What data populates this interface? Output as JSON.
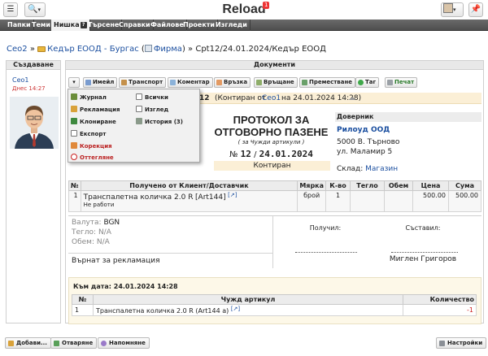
{
  "app": {
    "title": "Reload",
    "badge": "1"
  },
  "menu": [
    "Папки",
    "Теми",
    "Нишка",
    "Търсене",
    "Справки",
    "Файлове",
    "Проекти",
    "Изгледи"
  ],
  "breadcrumb": {
    "user": "Ceo2",
    "folder": "Кедър ЕООД - Бургас",
    "firm": "Фирма",
    "current": "Срt12/24.01.2024/Кедър ЕООД"
  },
  "columns": {
    "created": "Създаване",
    "documents": "Документи"
  },
  "creator": {
    "name": "Ceo1",
    "time": "Днес 14:27"
  },
  "toolbar": [
    "Имейл",
    "Транспорт",
    "Коментар",
    "Връзка",
    "Връщане",
    "Преместване",
    "Таг",
    "Печат"
  ],
  "dropdown": {
    "left": [
      "Журнал",
      "Рекламация",
      "Клониране",
      "Експорт",
      "Корекция",
      "Оттегляне"
    ],
    "right": [
      "Всички",
      "Изглед",
      "История (3)"
    ]
  },
  "doc": {
    "status_code": "12",
    "status_prefix": "(Контиран от",
    "status_user": "Ceo1",
    "status_suffix": "на 24.01.2024 14:28)",
    "title": "ПРОТОКОЛ ЗА ОТГОВОРНО ПАЗЕНЕ",
    "subtitle": "( за Чужди артикули )",
    "num_prefix": "№",
    "number": "12",
    "date": "24.01.2024",
    "state": "Контиран"
  },
  "recipient": {
    "head": "Доверник",
    "name": "Рилоуд ООД",
    "addr1": "5000 В. Търново",
    "addr2": "ул. Маламир 5",
    "store_label": "Склад:",
    "store": "Магазин"
  },
  "items": {
    "headers": [
      "№",
      "Получено от Клиент/Доставчик",
      "Мярка",
      "К-во",
      "Тегло",
      "Обем",
      "Цена",
      "Сума"
    ],
    "rows": [
      {
        "n": "1",
        "name": "Транспалетна количка 2.0 R",
        "code": "[Art144]",
        "note": "Не работи",
        "unit": "брой",
        "qty": "1",
        "weight": "",
        "volume": "",
        "price": "500.00",
        "sum": "500.00"
      }
    ]
  },
  "summary": {
    "currency_label": "Валута:",
    "currency": "BGN",
    "weight_label": "Тегло:",
    "weight": "N/A",
    "volume_label": "Обем:",
    "volume": "N/A",
    "reason": "Върнат за рекламация",
    "received_label": "Получил:",
    "composed_label": "Съставил:",
    "composed_name": "Миглен Григоров"
  },
  "history": {
    "date_line": "Към дата: 24.01.2024 14:28",
    "headers": [
      "№",
      "Чужд артикул",
      "Количество"
    ],
    "rows": [
      {
        "n": "1",
        "name": "Транспалетна количка 2.0 R (Art144 а)",
        "qty": "-1"
      }
    ]
  },
  "footer": {
    "add": "Добави...",
    "open": "Отваряне",
    "remind": "Напомняне",
    "settings": "Настройки"
  }
}
